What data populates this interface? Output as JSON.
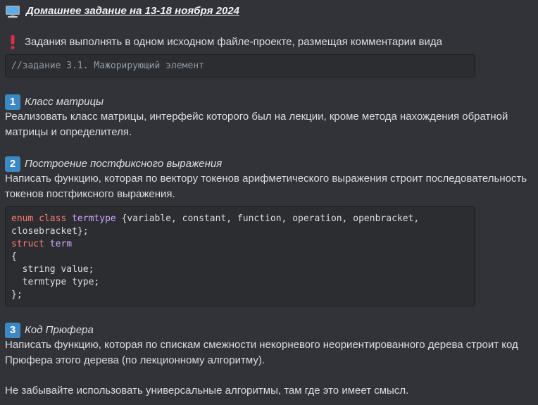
{
  "title": "Домашнее задание на 13-18 ноября 2024",
  "notice": "Задания выполнять в одном исходном файле-проекте, размещая комментарии вида",
  "comment_example": "//задание 3.1. Мажорирующий элемент",
  "tasks": [
    {
      "number": "1",
      "title": "Класс матрицы",
      "description": "Реализовать класс матрицы, интерфейс которого был на лекции, кроме метода нахождения обратной матрицы и определителя."
    },
    {
      "number": "2",
      "title": "Построение постфиксного выражения",
      "description": "Написать функцию, которая по вектору токенов арифметического выражения строит последовательность токенов постфиксного выражения."
    },
    {
      "number": "3",
      "title": "Код Прюфера",
      "description": "Написать функцию, которая по спискам смежности некорневого неориентированного дерева строит код Прюфера этого дерева (по лекционному алгоритму)."
    }
  ],
  "code": {
    "l1_kw": "enum class",
    "l1_ty": "termtype",
    "l1_rest": "{variable, constant, function, operation, openbracket,",
    "l2": "closebracket};",
    "l3_kw": "struct",
    "l3_ty": "term",
    "l4": "{",
    "l5": "  string value;",
    "l6": "  termtype type;",
    "l7": "};"
  },
  "footer": "Не забывайте использовать универсальные алгоритмы, там где это имеет смысл.",
  "icons": {
    "title": "computer-icon",
    "notice": "exclamation-icon"
  },
  "colors": {
    "background": "#313338",
    "codeblock": "#2b2d31",
    "badge": "#3b88c3",
    "keyword": "#ff7b72",
    "type": "#d2a8ff"
  }
}
